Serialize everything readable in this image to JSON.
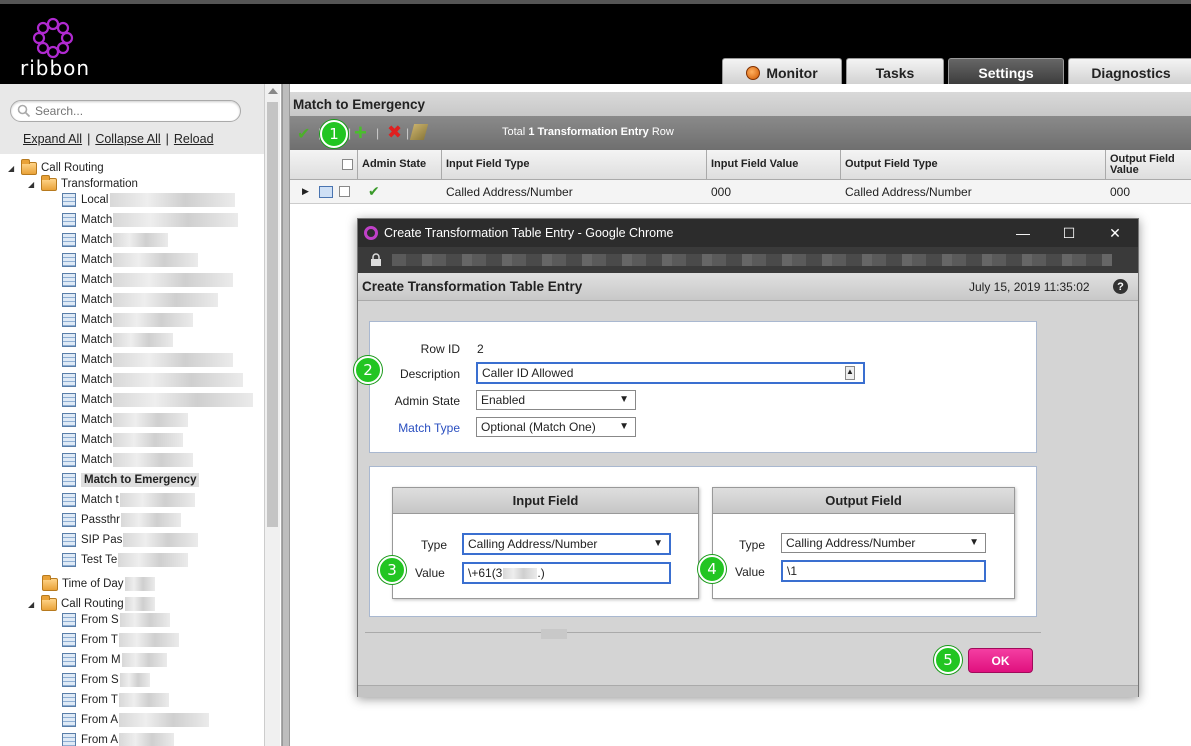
{
  "header": {
    "logo_text": "ribbon",
    "tabs": [
      {
        "label": "Monitor"
      },
      {
        "label": "Tasks"
      },
      {
        "label": "Settings"
      },
      {
        "label": "Diagnostics"
      }
    ],
    "active_tab": "Settings"
  },
  "sidebar": {
    "search_placeholder": "Search...",
    "links": {
      "expand": "Expand All",
      "collapse": "Collapse All",
      "reload": "Reload"
    },
    "tree": {
      "call_routing": "Call Routing",
      "transformation": "Transformation",
      "items": [
        "Local",
        "Match",
        "Match",
        "Match",
        "Match",
        "Match",
        "Match",
        "Match",
        "Match",
        "Match",
        "Match",
        "Match",
        "Match",
        "Match"
      ],
      "selected": "Match to Emergency",
      "after_selected": [
        "Match t",
        "Passthr",
        "SIP Pas",
        "Test Te"
      ],
      "time_of_day": "Time of Day",
      "call_routing_table": "Call Routing",
      "call_routing_items": [
        "From S",
        "From T",
        "From M",
        "From S",
        "From T",
        "From A",
        "From A"
      ]
    }
  },
  "main": {
    "title": "Match to Emergency",
    "toolbar_total": "Total",
    "toolbar_count": "1",
    "toolbar_entity": "Transformation Entry",
    "toolbar_suffix": "Row",
    "columns": {
      "admin_state": "Admin State",
      "input_field_type": "Input Field Type",
      "input_field_value": "Input Field Value",
      "output_field_type": "Output Field Type",
      "output_field_value": "Output Field Value"
    },
    "row": {
      "input_field_type": "Called Address/Number",
      "input_field_value": "000",
      "output_field_type": "Called Address/Number",
      "output_field_value": "000"
    }
  },
  "markers": [
    "1",
    "2",
    "3",
    "4",
    "5"
  ],
  "dialog": {
    "window_title": "Create Transformation Table Entry - Google Chrome",
    "header_title": "Create Transformation Table Entry",
    "datetime": "July 15, 2019 11:35:02",
    "help": "?",
    "row_id_label": "Row ID",
    "row_id_value": "2",
    "description_label": "Description",
    "description_value": "Caller ID Allowed",
    "admin_state_label": "Admin State",
    "admin_state_value": "Enabled",
    "match_type_label": "Match Type",
    "match_type_value": "Optional (Match One)",
    "input_field": {
      "title": "Input Field",
      "type_label": "Type",
      "type_value": "Calling Address/Number",
      "value_label": "Value",
      "value_prefix": "\\+61(3",
      "value_suffix": ".)"
    },
    "output_field": {
      "title": "Output Field",
      "type_label": "Type",
      "type_value": "Calling Address/Number",
      "value_label": "Value",
      "value_value": "\\1"
    },
    "ok_label": "OK"
  },
  "colors": {
    "accent_pink": "#e0107e",
    "marker_green": "#22c522",
    "logo_purple": "#b02ad0"
  }
}
